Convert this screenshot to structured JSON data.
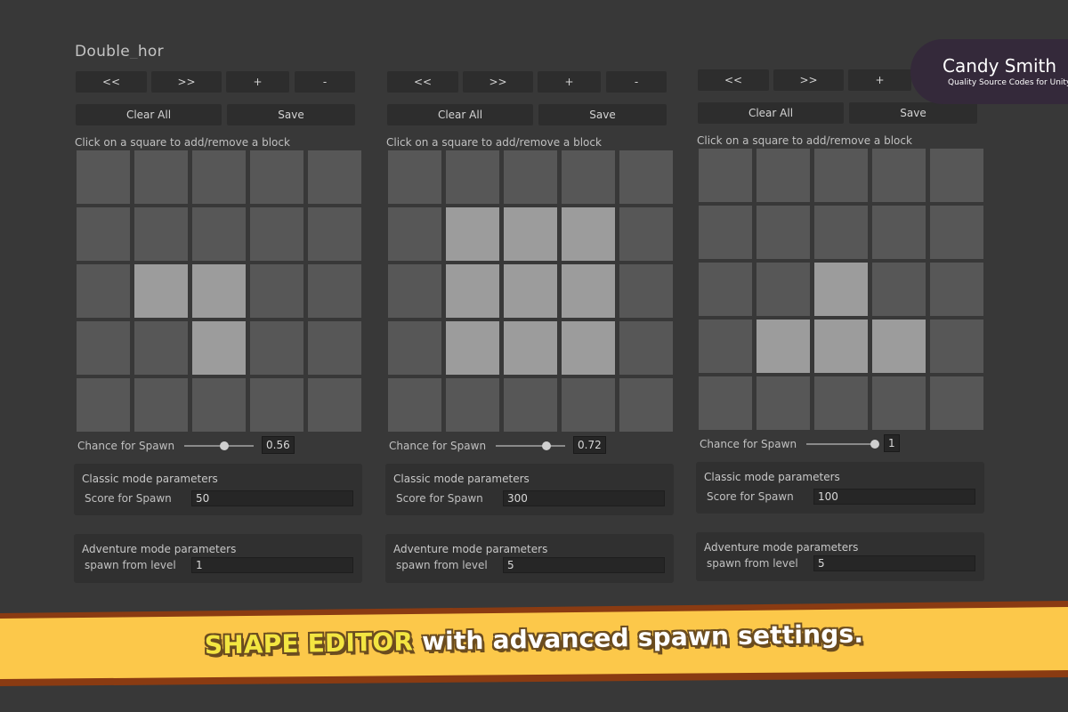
{
  "editor": {
    "shape_title": "Double_hor",
    "panels": [
      {
        "nav": [
          "<<",
          ">>",
          "+",
          "-"
        ],
        "clear_label": "Clear All",
        "save_label": "Save",
        "hint": "Click on a square to add/remove a block",
        "grid": [
          [
            0,
            0,
            0,
            0,
            0
          ],
          [
            0,
            0,
            0,
            0,
            0
          ],
          [
            0,
            1,
            1,
            0,
            0
          ],
          [
            0,
            0,
            1,
            0,
            0
          ],
          [
            0,
            0,
            0,
            0,
            0
          ]
        ],
        "chance_label": "Chance for Spawn",
        "chance_value": "0.56",
        "chance_level": 0.56,
        "classic_title": "Classic mode parameters",
        "score_label": "Score for Spawn",
        "score_value": "50",
        "adventure_title": "Adventure mode parameters",
        "level_label": "spawn from level",
        "level_value": "1"
      },
      {
        "nav": [
          "<<",
          ">>",
          "+",
          "-"
        ],
        "clear_label": "Clear All",
        "save_label": "Save",
        "hint": "Click on a square to add/remove a block",
        "grid": [
          [
            0,
            0,
            0,
            0,
            0
          ],
          [
            0,
            1,
            1,
            1,
            0
          ],
          [
            0,
            1,
            1,
            1,
            0
          ],
          [
            0,
            1,
            1,
            1,
            0
          ],
          [
            0,
            0,
            0,
            0,
            0
          ]
        ],
        "chance_label": "Chance for Spawn",
        "chance_value": "0.72",
        "chance_level": 0.72,
        "classic_title": "Classic mode parameters",
        "score_label": "Score for Spawn",
        "score_value": "300",
        "adventure_title": "Adventure mode parameters",
        "level_label": "spawn from level",
        "level_value": "5"
      },
      {
        "nav": [
          "<<",
          ">>",
          "+"
        ],
        "clear_label": "Clear All",
        "save_label": "Save",
        "hint": "Click on a square to add/remove a block",
        "grid": [
          [
            0,
            0,
            0,
            0,
            0
          ],
          [
            0,
            0,
            0,
            0,
            0
          ],
          [
            0,
            0,
            1,
            0,
            0
          ],
          [
            0,
            1,
            1,
            1,
            0
          ],
          [
            0,
            0,
            0,
            0,
            0
          ]
        ],
        "chance_label": "Chance for Spawn",
        "chance_value": "1",
        "chance_level": 1,
        "classic_title": "Classic mode parameters",
        "score_label": "Score for Spawn",
        "score_value": "100",
        "adventure_title": "Adventure mode parameters",
        "level_label": "spawn from level",
        "level_value": "5"
      }
    ]
  },
  "logo": {
    "brand": "Candy Smith",
    "tagline": "Quality Source Codes for Unity"
  },
  "banner": {
    "highlight": "SHAPE EDITOR",
    "rest": " with advanced spawn settings.",
    "colors": {
      "band": "#fcc84a",
      "edge": "#8a3b12",
      "highlight": "#f3e541"
    }
  }
}
